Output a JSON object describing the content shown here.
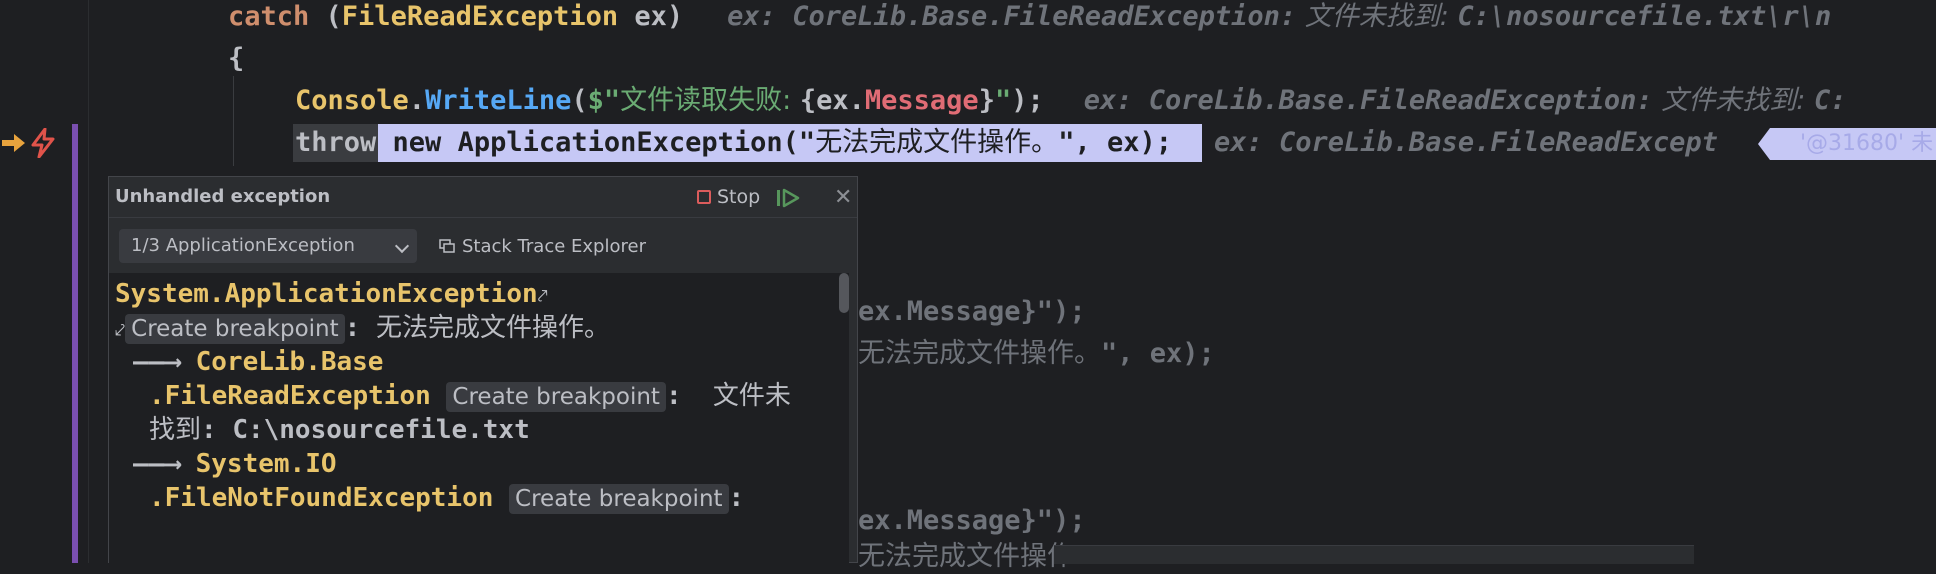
{
  "editor": {
    "line1": {
      "kw": "catch",
      "open": " (",
      "type": "FileReadException",
      "var": " ex)",
      "hint": "ex: CoreLib.Base.FileReadException:",
      "hint_cn": " 文件未找到: ",
      "hint_tail": "C:\\nosourcefile.txt\\r\\n"
    },
    "line2": {
      "brace": "{"
    },
    "line3": {
      "cls": "Console",
      "dot": ".",
      "method": "WriteLine",
      "p1": "(",
      "dollar": "$",
      "q1": "\"",
      "cn": "文件读取失败: ",
      "interp_open": "{ex.",
      "field": "Message",
      "interp_close": "}",
      "q2": "\"",
      "end": ");",
      "hint": "ex: CoreLib.Base.FileReadException:",
      "hint_cn": " 文件未找到: ",
      "hint_tail": "C:"
    },
    "line4": {
      "throw": "throw",
      "new": " new ",
      "type": "ApplicationException",
      "p1": "(\"",
      "cn": "无法完成文件操作。",
      "tail": "\", ex);",
      "hint": "ex: CoreLib.Base.FileReadExcept",
      "badge": "'@31680'",
      "badge_tail": "未"
    },
    "bg1": {
      "a": "ex.Message}\");"
    },
    "bg2": {
      "cn": "无法完成文件操作。",
      "b": "\", ex);"
    },
    "bg3": {
      "a": "ex.Message}\");"
    },
    "bg4": {
      "cn": "无法完成文件操作"
    }
  },
  "popup": {
    "title": "Unhandled exception",
    "stop": "Stop",
    "selector": "1/3 ApplicationException",
    "stack_trace_explorer": "Stack Trace Explorer",
    "trace": {
      "l1": "System.ApplicationException",
      "bp": "Create breakpoint",
      "l2_colon": ": ",
      "l2_msg": "无法完成文件操作。",
      "arrow": "——⟶",
      "l3": "CoreLib.Base",
      "l4": ".FileReadException",
      "l4_colon": ": ",
      "l4_msg": "文件未",
      "l5_cn": "找到",
      "l5": ": C:\\nosourcefile.txt",
      "l6": "System.IO",
      "l7": ".FileNotFoundException",
      "l7_colon": ":"
    }
  }
}
